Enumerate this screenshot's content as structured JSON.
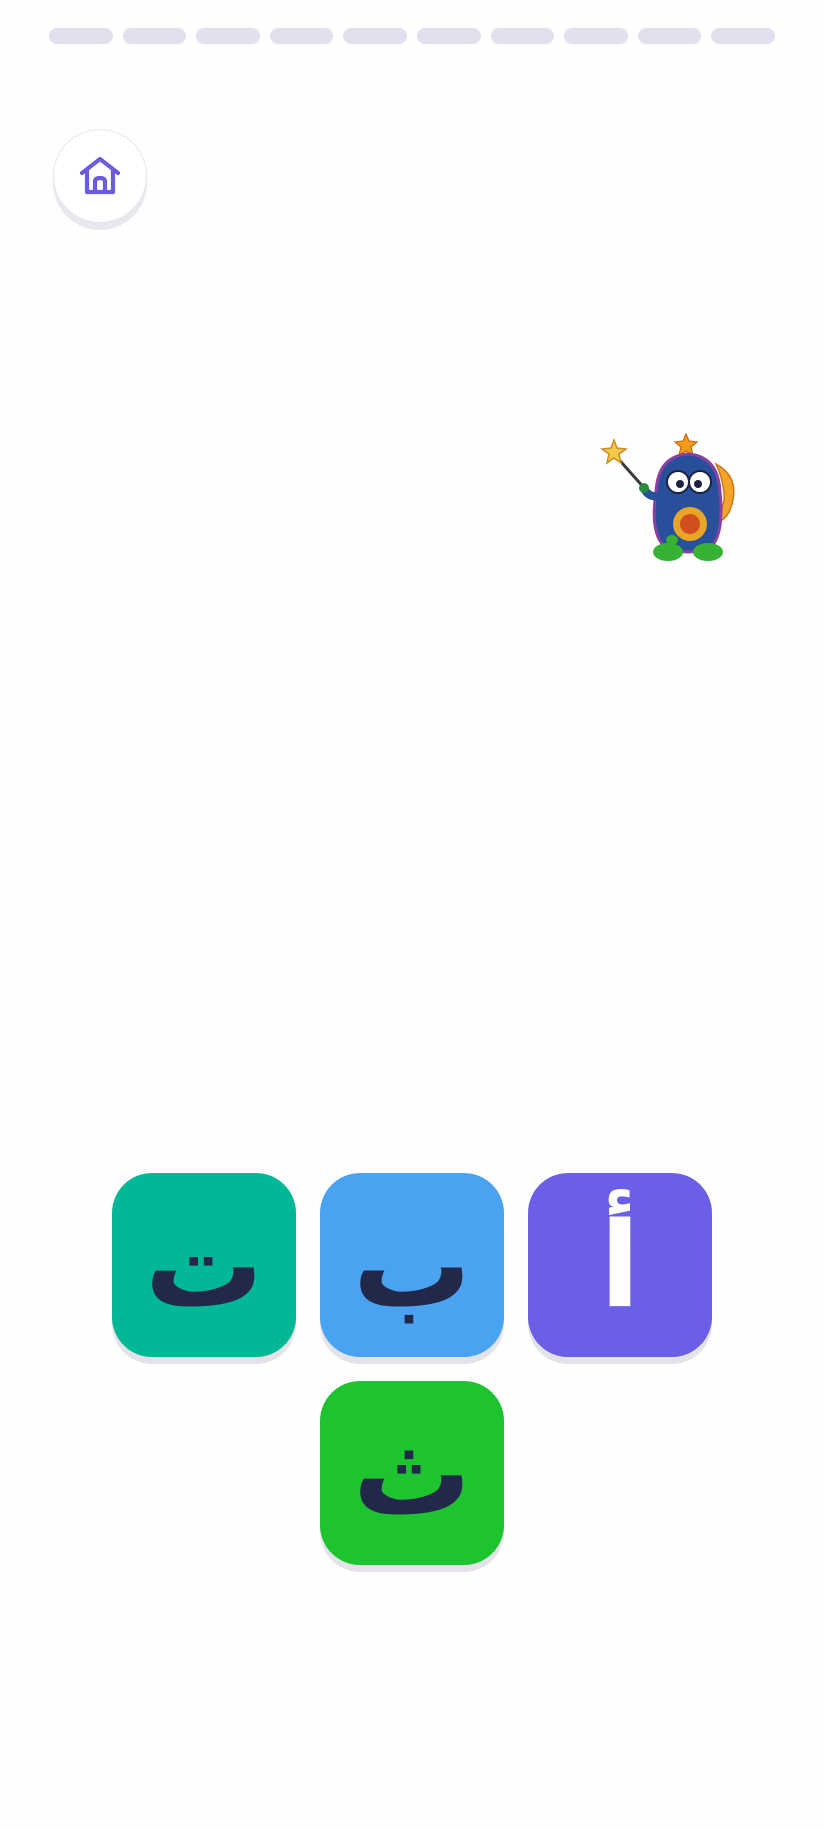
{
  "progress": {
    "total_steps": 10,
    "completed_steps": 0,
    "track_color": "#e1e0ef"
  },
  "home_button": {
    "icon": "home-icon",
    "icon_color": "#6a5cdf"
  },
  "mascot": {
    "icon": "wizard-monster-mascot"
  },
  "letter_tiles": [
    {
      "letter": "ت",
      "color": "#01b896"
    },
    {
      "letter": "ب",
      "color": "#4aa3f1"
    },
    {
      "letter": "أ",
      "color": "#6c5fe7"
    },
    {
      "letter": "ث",
      "color": "#1dc42f"
    }
  ]
}
